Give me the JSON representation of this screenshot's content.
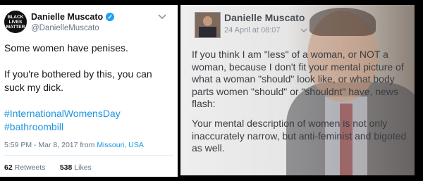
{
  "tweet": {
    "avatar_text": [
      "BLACK",
      "LIVES",
      "MATTER"
    ],
    "name": "Danielle Muscato",
    "verified_glyph": "✓",
    "handle": "@DanielleMuscato",
    "line1": "Some women have penises.",
    "line2": "If you're bothered by this, you can suck my dick.",
    "hashtag1": "#InternationalWomensDay",
    "hashtag2": "#bathroombill",
    "timestamp": "5:59 PM - Mar 8, 2017 from",
    "location": "Missouri, USA",
    "retweets_count": "62",
    "retweets_label": "Retweets",
    "likes_count": "538",
    "likes_label": "Likes"
  },
  "facebook_post": {
    "name": "Danielle Muscato",
    "date": "24 April at 08:07",
    "paragraph1": "If you think I am \"less\" of a woman, or NOT a woman, because I don't fit your mental picture of what a woman \"should\" look like, or what body parts women \"should\" or \"shouldnt\" have, news flash:",
    "paragraph2": "Your mental description of women is not only inaccurately narrow, but anti-feminist and bigoted as well."
  },
  "colors": {
    "link_blue": "#1b95e0",
    "verified_blue": "#1da1f2",
    "text_dark": "#14171a",
    "text_muted": "#657786"
  }
}
